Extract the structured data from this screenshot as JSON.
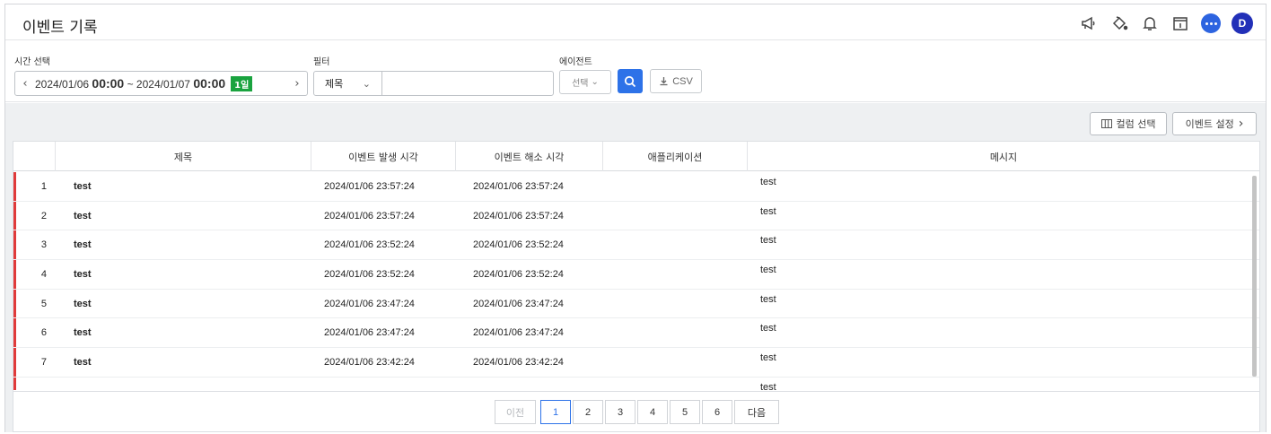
{
  "header": {
    "title": "이벤트 기록",
    "icons": [
      "megaphone-icon",
      "paint-bucket-icon",
      "bell-icon",
      "calendar-icon",
      "chat-icon"
    ],
    "avatar_letter": "D"
  },
  "filters": {
    "time_label": "시간 선택",
    "time_start_date": "2024/01/06",
    "time_start_time": "00:00",
    "time_separator": "~",
    "time_end_date": "2024/01/07",
    "time_end_time": "00:00",
    "range_badge": "1일",
    "filter_label": "필터",
    "filter_field": "제목",
    "filter_value": "",
    "agent_label": "에이전트",
    "agent_placeholder": "선택",
    "csv_label": "CSV"
  },
  "toolbar": {
    "column_select": "컬럼 선택",
    "event_settings": "이벤트 설정"
  },
  "table": {
    "columns": [
      "",
      "제목",
      "이벤트 발생 시각",
      "이벤트 해소 시각",
      "애플리케이션",
      "메시지"
    ],
    "rows": [
      {
        "num": "1",
        "title": "test",
        "start": "2024/01/06 23:57:24",
        "end": "2024/01/06 23:57:24",
        "app": "",
        "message": "test"
      },
      {
        "num": "2",
        "title": "test",
        "start": "2024/01/06 23:57:24",
        "end": "2024/01/06 23:57:24",
        "app": "",
        "message": "test"
      },
      {
        "num": "3",
        "title": "test",
        "start": "2024/01/06 23:52:24",
        "end": "2024/01/06 23:52:24",
        "app": "",
        "message": "test"
      },
      {
        "num": "4",
        "title": "test",
        "start": "2024/01/06 23:52:24",
        "end": "2024/01/06 23:52:24",
        "app": "",
        "message": "test"
      },
      {
        "num": "5",
        "title": "test",
        "start": "2024/01/06 23:47:24",
        "end": "2024/01/06 23:47:24",
        "app": "",
        "message": "test"
      },
      {
        "num": "6",
        "title": "test",
        "start": "2024/01/06 23:47:24",
        "end": "2024/01/06 23:47:24",
        "app": "",
        "message": "test"
      },
      {
        "num": "7",
        "title": "test",
        "start": "2024/01/06 23:42:24",
        "end": "2024/01/06 23:42:24",
        "app": "",
        "message": "test"
      },
      {
        "num": "",
        "title": "",
        "start": "",
        "end": "",
        "app": "",
        "message": "test"
      }
    ]
  },
  "pagination": {
    "prev": "이전",
    "pages": [
      "1",
      "2",
      "3",
      "4",
      "5",
      "6"
    ],
    "current": "1",
    "next": "다음"
  },
  "colors": {
    "accent": "#2d72e8",
    "badge_green": "#1aa33f",
    "row_marker": "#e03a3a",
    "avatar": "#2230b8"
  }
}
